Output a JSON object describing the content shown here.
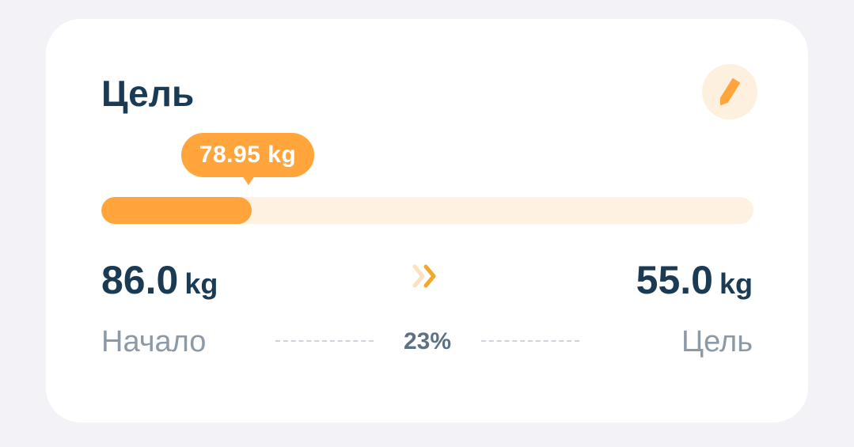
{
  "card": {
    "title": "Цель",
    "edit_icon": "pencil-icon",
    "current_weight_label": "78.95 kg",
    "progress": {
      "fraction": 0.23,
      "percent_label": "23%"
    },
    "start": {
      "value": "86.0",
      "unit": "kg",
      "label": "Начало"
    },
    "goal": {
      "value": "55.0",
      "unit": "kg",
      "label": "Цель"
    },
    "direction_icon": "double-chevron-right-icon"
  },
  "colors": {
    "accent": "#ffa53c",
    "accent_light": "#fef1e2",
    "text_dark": "#1b3a54",
    "text_muted": "#8c9aa8",
    "background": "#f2f2f7",
    "card": "#ffffff"
  }
}
